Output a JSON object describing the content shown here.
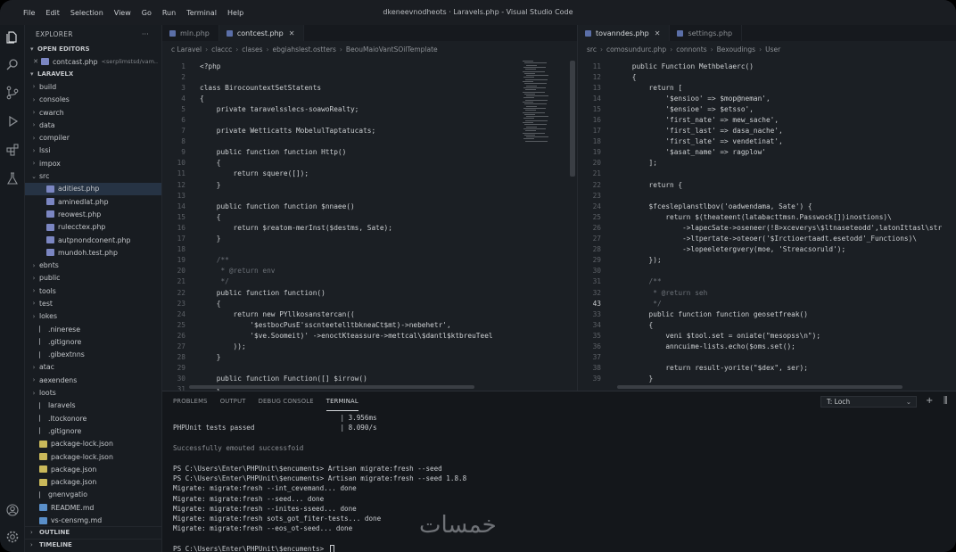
{
  "window": {
    "title": "dkeneevnodheots · Laravels.php - Visual Studio Code",
    "menu": [
      "File",
      "Edit",
      "Selection",
      "View",
      "Go",
      "Run",
      "Terminal",
      "Help"
    ]
  },
  "sidebar": {
    "header": "EXPLORER",
    "more": "···",
    "open_editors_label": "OPEN EDITORS",
    "open_editor": {
      "name": "contcast.php",
      "detail": "<serplimstsd/vam.."
    },
    "project_label": "LARAVELX",
    "tree": [
      {
        "label": "build",
        "type": "folder",
        "depth": 1
      },
      {
        "label": "consoles",
        "type": "folder",
        "depth": 1
      },
      {
        "label": "cwarch",
        "type": "folder",
        "depth": 1
      },
      {
        "label": "data",
        "type": "folder",
        "depth": 1
      },
      {
        "label": "compiler",
        "type": "folder",
        "depth": 1
      },
      {
        "label": "lssi",
        "type": "folder",
        "depth": 1
      },
      {
        "label": "impox",
        "type": "folder",
        "depth": 1
      },
      {
        "label": "src",
        "type": "folder-open",
        "depth": 1
      },
      {
        "label": "aditiest.php",
        "type": "php",
        "depth": 2,
        "active": true
      },
      {
        "label": "aminedlat.php",
        "type": "php",
        "depth": 2
      },
      {
        "label": "reowest.php",
        "type": "php",
        "depth": 2
      },
      {
        "label": "rulecctex.php",
        "type": "php",
        "depth": 2
      },
      {
        "label": "autpnondconent.php",
        "type": "php",
        "depth": 2
      },
      {
        "label": "mundoh.test.php",
        "type": "php",
        "depth": 2
      },
      {
        "label": "ebnts",
        "type": "folder",
        "depth": 1
      },
      {
        "label": "public",
        "type": "folder",
        "depth": 1
      },
      {
        "label": "tools",
        "type": "folder",
        "depth": 1
      },
      {
        "label": "test",
        "type": "folder",
        "depth": 1
      },
      {
        "label": "lokes",
        "type": "folder",
        "depth": 1
      },
      {
        "label": ".ninerese",
        "type": "file",
        "depth": 1
      },
      {
        "label": ".gitignore",
        "type": "file",
        "depth": 1
      },
      {
        "label": ".gibextnns",
        "type": "file",
        "depth": 1
      },
      {
        "label": "atac",
        "type": "folder",
        "depth": 1
      },
      {
        "label": "aexendens",
        "type": "folder",
        "depth": 1
      },
      {
        "label": "loots",
        "type": "folder",
        "depth": 1
      },
      {
        "label": "laravels",
        "type": "file",
        "depth": 1
      },
      {
        "label": ".ltockonore",
        "type": "file",
        "depth": 1
      },
      {
        "label": ".gitignore",
        "type": "file",
        "depth": 1
      },
      {
        "label": "package-lock.json",
        "type": "json",
        "depth": 1
      },
      {
        "label": "package-lock.json",
        "type": "json",
        "depth": 1
      },
      {
        "label": "package.json",
        "type": "json",
        "depth": 1
      },
      {
        "label": "package.json",
        "type": "json",
        "depth": 1
      },
      {
        "label": "gnenvgatio",
        "type": "file",
        "depth": 1
      },
      {
        "label": "README.md",
        "type": "md",
        "depth": 1
      },
      {
        "label": "vs-censmg.md",
        "type": "md",
        "depth": 1
      }
    ],
    "outline_label": "OUTLINE",
    "timeline_label": "TIMELINE"
  },
  "editor_left": {
    "tabs": [
      {
        "label": "mln.php",
        "active": false
      },
      {
        "label": "contcest.php",
        "active": true
      }
    ],
    "breadcrumbs": [
      "c Laravel",
      "claccc",
      "clases",
      "ebgiahslest.ostters",
      "BeouMaioVantSOilTemplate"
    ],
    "lines": [
      {
        "n": "1",
        "t": "<?php"
      },
      {
        "n": "2",
        "t": ""
      },
      {
        "n": "3",
        "t": "class BirocountextSetStatents"
      },
      {
        "n": "4",
        "t": "{"
      },
      {
        "n": "5",
        "t": "    private taravelsslecs-soawoRealty;"
      },
      {
        "n": "6",
        "t": ""
      },
      {
        "n": "7",
        "t": "    private Wetticatts MobelulTaptatucats;"
      },
      {
        "n": "8",
        "t": ""
      },
      {
        "n": "9",
        "t": "    public function function Http()"
      },
      {
        "n": "10",
        "t": "    {"
      },
      {
        "n": "11",
        "t": "        return squere([]);"
      },
      {
        "n": "12",
        "t": "    }"
      },
      {
        "n": "13",
        "t": ""
      },
      {
        "n": "14",
        "t": "    public function function $nnaee()"
      },
      {
        "n": "15",
        "t": "    {"
      },
      {
        "n": "16",
        "t": "        return $reatom-merInst($destms, Sate);"
      },
      {
        "n": "17",
        "t": "    }"
      },
      {
        "n": "18",
        "t": ""
      },
      {
        "n": "19",
        "t": "    /**"
      },
      {
        "n": "20",
        "t": "     * @return env"
      },
      {
        "n": "21",
        "t": "     */"
      },
      {
        "n": "22",
        "t": "    public function function()"
      },
      {
        "n": "23",
        "t": "    {"
      },
      {
        "n": "24",
        "t": "        return new PYllkosanstercan(("
      },
      {
        "n": "25",
        "t": "            '$estbocPusE'sscnteetelltbkneaCt$mt)->nebehetr',"
      },
      {
        "n": "26",
        "t": "            '$ve.Soomeit)' ->enoctKteassure->mettcal\\$dantl$ktbreuTeel"
      },
      {
        "n": "27",
        "t": "        ));"
      },
      {
        "n": "28",
        "t": "    }"
      },
      {
        "n": "29",
        "t": ""
      },
      {
        "n": "30",
        "t": "    public function Function([] $irrow()"
      },
      {
        "n": "31",
        "t": "    {"
      }
    ]
  },
  "editor_right": {
    "tabs": [
      {
        "label": "tovanndes.php",
        "active": true
      },
      {
        "label": "settings.php",
        "active": false
      }
    ],
    "breadcrumbs": [
      "src",
      "comosundurc.php",
      "connonts",
      "Bexoudings",
      "User"
    ],
    "lines": [
      {
        "n": "11",
        "t": "    public Function Methbelaerc()"
      },
      {
        "n": "12",
        "t": "    {"
      },
      {
        "n": "13",
        "t": "        return ["
      },
      {
        "n": "14",
        "t": "            '$ensioo' => $mop@neman',"
      },
      {
        "n": "15",
        "t": "            '$ensioe' => $etsso',"
      },
      {
        "n": "16",
        "t": "            'first_nate' => mew_sache',"
      },
      {
        "n": "17",
        "t": "            'first_last' => dasa_nache',"
      },
      {
        "n": "18",
        "t": "            'first_late' => vendetinat',"
      },
      {
        "n": "19",
        "t": "            '$asat_name' => ragplow'"
      },
      {
        "n": "20",
        "t": "        ];"
      },
      {
        "n": "21",
        "t": ""
      },
      {
        "n": "22",
        "t": "        return {"
      },
      {
        "n": "23",
        "t": ""
      },
      {
        "n": "24",
        "t": "        $fcesleplanstlbov('oadwendama, Sate') {"
      },
      {
        "n": "25",
        "t": "            return $(theateent(latabacttmsn.Passwock[])inostions)\\"
      },
      {
        "n": "26",
        "t": "                ->lapecSate->oseneer(!8>xceverys\\$ltnaseteodd',latonIttasl\\str"
      },
      {
        "n": "27",
        "t": "                ->ltpertate->oteoer('$Irctioertaadt.esetodd'_Functions)\\"
      },
      {
        "n": "28",
        "t": "                ->lopeeletergvery(moe, 'Streacsoruld');"
      },
      {
        "n": "29",
        "t": "        });"
      },
      {
        "n": "30",
        "t": ""
      },
      {
        "n": "31",
        "t": "        /**"
      },
      {
        "n": "32",
        "t": "         * @return seh"
      },
      {
        "n": "43",
        "t": "         */",
        "current": true
      },
      {
        "n": "33",
        "t": "        public function function geosetfreak()"
      },
      {
        "n": "34",
        "t": "        {"
      },
      {
        "n": "35",
        "t": "            veni $tool.set = oniate(\"mesopss\\n\");"
      },
      {
        "n": "36",
        "t": "            anncuime-lists.echo($oms.set();"
      },
      {
        "n": "37",
        "t": ""
      },
      {
        "n": "38",
        "t": "            return result-yorite(\"$dex\", ser);"
      },
      {
        "n": "39",
        "t": "        }"
      }
    ]
  },
  "panel": {
    "tabs": [
      {
        "label": "PROBLEMS",
        "active": false,
        "badge": "8"
      },
      {
        "label": "OUTPUT",
        "active": false
      },
      {
        "label": "DEBUG CONSOLE",
        "active": false
      },
      {
        "label": "TERMINAL",
        "active": true
      }
    ],
    "terminal_select": "T: Loch",
    "add_icon": "+",
    "split_icon": "⫼",
    "lines": [
      {
        "t": "                                         | 3.956ms",
        "dim": false
      },
      {
        "t": "PHPUnit tests passed                     | 8.090/s",
        "dim": false
      },
      {
        "t": "",
        "dim": false
      },
      {
        "t": "Successfully emouted successfoid",
        "dim": true
      },
      {
        "t": "",
        "dim": false
      },
      {
        "t": "PS C:\\Users\\Enter\\PHPUnit\\$encuments> Artisan migrate:fresh --seed",
        "dim": false
      },
      {
        "t": "PS C:\\Users\\Enter\\PHPUnit\\$encuments> Artisan migrate:fresh --seed 1.8.8",
        "dim": false
      },
      {
        "t": "Migrate: migrate:fresh --int_cevemand... done",
        "dim": false
      },
      {
        "t": "Migrate: migrate:fresh --seed... done",
        "dim": false
      },
      {
        "t": "Migrate: migrate:fresh --inites-sseed... done",
        "dim": false
      },
      {
        "t": "Migrate: migrate:fresh sots_got_fiter-tests... done",
        "dim": false
      },
      {
        "t": "Migrate: migrate:fresh --eos_ot-seed... done",
        "dim": false
      },
      {
        "t": "",
        "dim": false
      },
      {
        "t": "PS C:\\Users\\Enter\\PHPUnit\\$encuments> ",
        "dim": false,
        "cursor": true
      }
    ]
  },
  "watermark": "خمسات",
  "colors": {
    "background": "#15181d",
    "sidebar": "#181c21",
    "editor": "#1b1f24",
    "panel": "#14171b",
    "selection": "#263344",
    "php_icon": "#7b86c2",
    "json_icon": "#c9b85a",
    "md_icon": "#5a8fc9"
  }
}
